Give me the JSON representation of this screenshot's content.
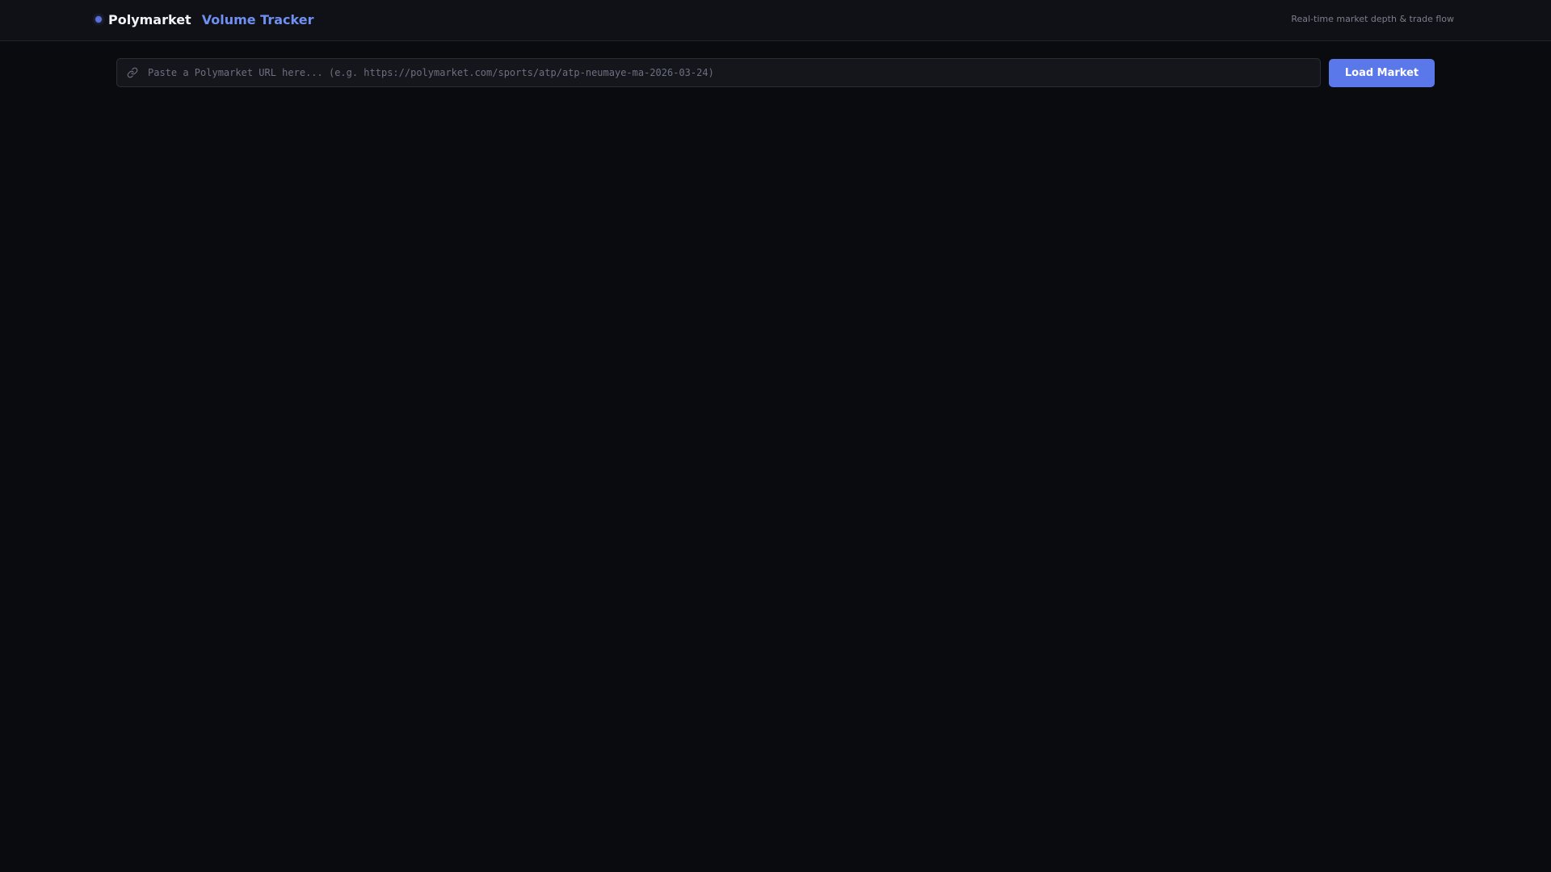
{
  "header": {
    "brand_name": "Polymarket",
    "brand_sub": "Volume Tracker",
    "tagline": "Real-time market depth & trade flow"
  },
  "loader": {
    "placeholder": "Paste a Polymarket URL here... (e.g. https://polymarket.com/sports/atp/atp-neumaye-ma-2026-03-24)",
    "value": "",
    "button_label": "Load Market",
    "icon": "link-icon"
  },
  "colors": {
    "background": "#0a0b0f",
    "header_bg": "#101116",
    "accent": "#5b78ea",
    "brand_sub": "#6f8ff2"
  }
}
